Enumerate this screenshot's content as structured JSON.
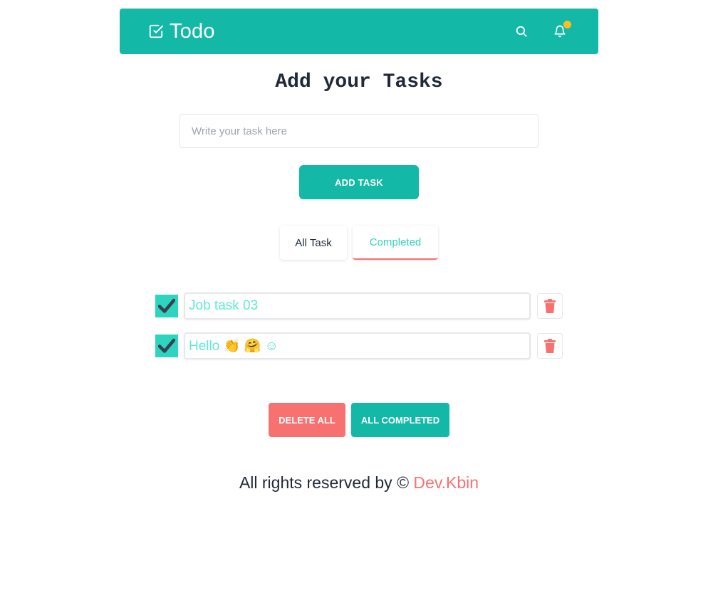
{
  "navbar": {
    "brand": "Todo",
    "brand_icon": "checkbox-icon",
    "search_icon": "search-icon",
    "bell_icon": "bell-icon",
    "background": "#14b8a6",
    "notification_dot_color": "#fbbf24"
  },
  "main": {
    "title": "Add your Tasks",
    "input_placeholder": "Write your task here",
    "input_value": "",
    "add_button": "ADD TASK"
  },
  "tabs": [
    {
      "label": "All Task",
      "active": false
    },
    {
      "label": "Completed",
      "active": true
    }
  ],
  "tasks": [
    {
      "text": "Job task 03",
      "completed": true
    },
    {
      "text": "Hello 👏 🤗 ☺",
      "completed": true
    }
  ],
  "actions": {
    "delete_all": "DELETE ALL",
    "all_completed": "ALL COMPLETED"
  },
  "footer": {
    "text": "All rights reserved by © ",
    "author": "Dev.Kbin"
  },
  "colors": {
    "primary": "#14b8a6",
    "accent": "#2dd4bf",
    "danger": "#f87171",
    "text": "#1f2937"
  }
}
